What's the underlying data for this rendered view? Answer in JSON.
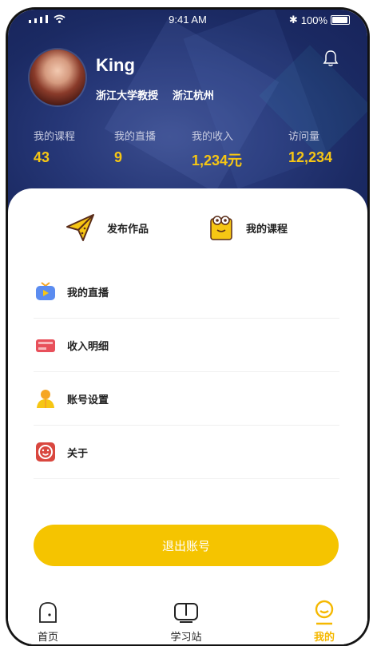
{
  "status": {
    "time": "9:41 AM",
    "battery": "100%"
  },
  "profile": {
    "name": "King",
    "title": "浙江大学教授",
    "location": "浙江杭州"
  },
  "stats": [
    {
      "label": "我的课程",
      "value": "43"
    },
    {
      "label": "我的直播",
      "value": "9"
    },
    {
      "label": "我的收入",
      "value": "1,234元"
    },
    {
      "label": "访问量",
      "value": "12,234"
    }
  ],
  "quick": {
    "publish": "发布作品",
    "courses": "我的课程"
  },
  "menu": [
    {
      "label": "我的直播",
      "icon": "tv-icon"
    },
    {
      "label": "收入明细",
      "icon": "wallet-icon"
    },
    {
      "label": "账号设置",
      "icon": "user-settings-icon"
    },
    {
      "label": "关于",
      "icon": "smile-icon"
    }
  ],
  "logout": "退出账号",
  "tabs": {
    "home": "首页",
    "study": "学习站",
    "mine": "我的"
  },
  "colors": {
    "accent": "#f5c400",
    "header": "#263777",
    "stat_value": "#f6c614"
  }
}
